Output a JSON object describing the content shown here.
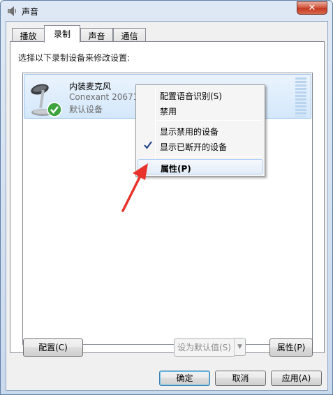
{
  "window": {
    "title": "声音",
    "close_label": "✕"
  },
  "tabs": [
    {
      "label": "播放"
    },
    {
      "label": "录制",
      "active": true
    },
    {
      "label": "声音"
    },
    {
      "label": "通信"
    }
  ],
  "panel": {
    "instruction": "选择以下录制设备来修改设置:"
  },
  "device": {
    "name": "内装麦克风",
    "driver": "Conexant 20671",
    "status": "默认设备",
    "icon": "microphone-icon",
    "status_icon": "green-check-icon"
  },
  "context_menu": {
    "items": [
      {
        "label": "配置语音识别(S)"
      },
      {
        "label": "禁用"
      },
      {
        "label": "显示禁用的设备"
      },
      {
        "label": "显示已断开的设备",
        "checked": true
      },
      {
        "label": "属性(P)",
        "bold": true,
        "highlighted": true
      }
    ]
  },
  "buttons": {
    "configure": "配置(C)",
    "set_default": "设为默认值(S)",
    "properties": "属性(P)",
    "ok": "确定",
    "cancel": "取消",
    "apply": "应用(A)"
  },
  "colors": {
    "arrow": "#e8322b",
    "selection": "#d4e8fb",
    "check": "#3da33d"
  }
}
